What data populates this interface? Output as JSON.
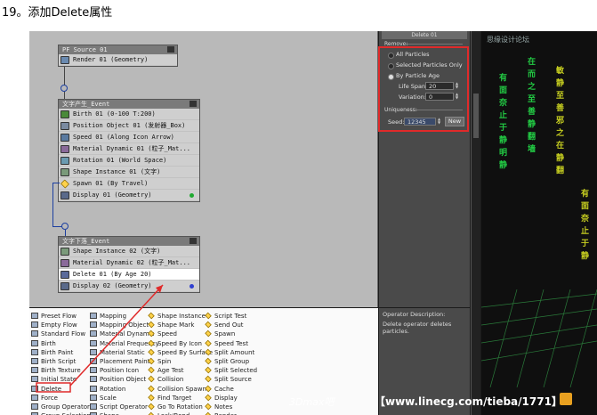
{
  "heading": "19。添加Delete属性",
  "particle_view": {
    "render_event": {
      "title": "PF Source 01",
      "ops": [
        "Render 01 (Geometry)"
      ]
    },
    "event1": {
      "title": "文字产生_Event",
      "ops": [
        "Birth 01 (0-100 T:200)",
        "Position Object 01 (发射器_Box)",
        "Speed 01 (Along Icon Arrow)",
        "Material Dynamic 01 (粒子_Mat...",
        "Rotation 01 (World Space)",
        "Shape Instance 01 (文字)",
        "Spawn 01 (By Travel)",
        "Display 01 (Geometry)"
      ]
    },
    "event2": {
      "title": "文字下落_Event",
      "ops": [
        "Shape Instance 02 (文字)",
        "Material Dynamic 02 (粒子_Mat...",
        "Delete 01 (By Age 20)",
        "Display 02 (Geometry)"
      ]
    }
  },
  "depot": {
    "col1": [
      "Preset Flow",
      "Empty Flow",
      "Standard Flow",
      "Birth",
      "Birth Paint",
      "Birth Script",
      "Birth Texture",
      "Initial State",
      "Delete",
      "Force",
      "Group Operator",
      "Group Selection"
    ],
    "col2": [
      "Mapping",
      "Mapping Object",
      "Material Dynamic",
      "Material Frequency",
      "Material Static",
      "Placement Paint",
      "Position Icon",
      "Position Object",
      "Rotation",
      "Scale",
      "Script Operator",
      "Shape"
    ],
    "col3": [
      "Shape Instance",
      "Shape Mark",
      "Speed",
      "Speed By Icon",
      "Speed By Surface",
      "Spin",
      "Age Test",
      "Collision",
      "Collision Spawn",
      "Find Target",
      "Go To Rotation",
      "Lock/Bond"
    ],
    "col4": [
      "Script Test",
      "Send Out",
      "Spawn",
      "Speed Test",
      "Split Amount",
      "Split Group",
      "Split Selected",
      "Split Source",
      "Cache",
      "Display",
      "Notes",
      "Render"
    ]
  },
  "params": {
    "title": "Delete 01",
    "remove_label": "Remove:",
    "all_particles": "All Particles",
    "selected_only": "Selected Particles Only",
    "by_age": "By Particle Age",
    "life_span_label": "Life Span:",
    "life_span_value": "20",
    "variation_label": "Variation:",
    "variation_value": "0",
    "uniqueness_label": "Uniqueness:",
    "seed_label": "Seed:",
    "seed_value": "12345",
    "new_button": "New"
  },
  "description": {
    "label": "Operator Description:",
    "text": "Delete operator deletes particles."
  },
  "viewport": {
    "title": "思缘设计论坛",
    "chars": [
      "有",
      "面",
      "奈",
      "止",
      "于",
      "静",
      "明",
      "静",
      "在",
      "而",
      "之",
      "至",
      "善",
      "静",
      "翻",
      "墙",
      "敏",
      "静",
      "至",
      "善",
      "邪",
      "之",
      "在",
      "静",
      "翻"
    ]
  },
  "footer": {
    "watermark": "3Dmax吧",
    "url": "【www.linecg.com/tieba/1771】"
  },
  "colors": {
    "red_highlight": "#e02a2a",
    "wire_blue": "#1c3fa0",
    "text_green": "#22cc44"
  }
}
